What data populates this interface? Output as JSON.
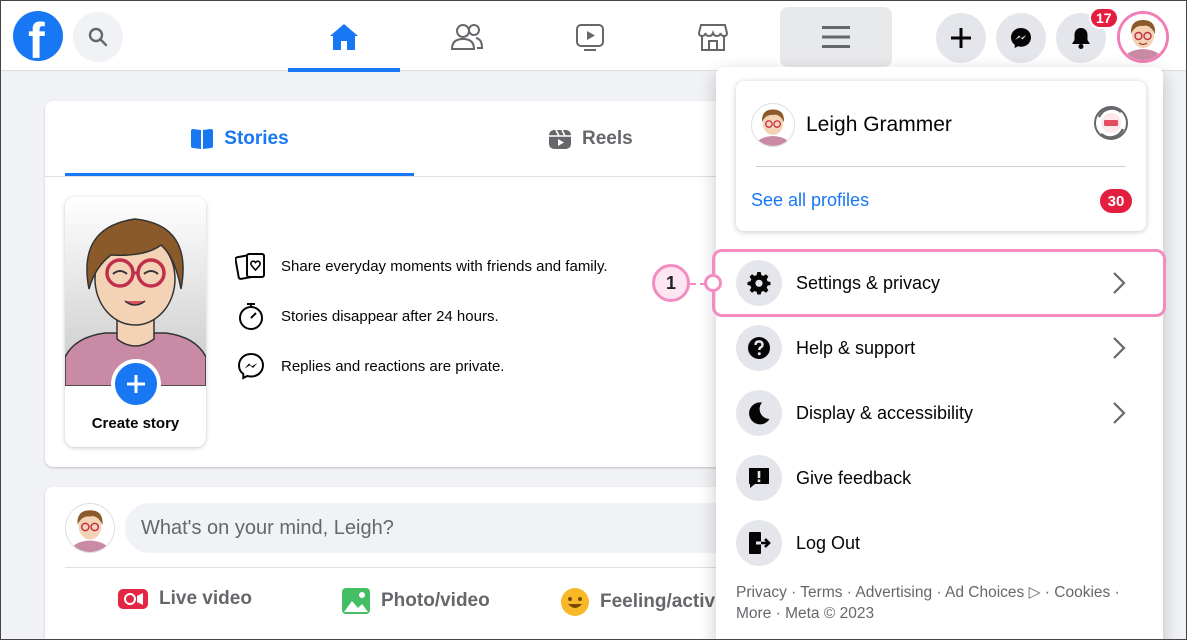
{
  "topbar": {
    "logo_letter": "f",
    "notification_count": "17",
    "icons": [
      "facebook-logo",
      "search-icon",
      "home-icon",
      "friends-icon",
      "watch-icon",
      "marketplace-icon",
      "menu-icon",
      "plus-icon",
      "messenger-icon",
      "bell-icon"
    ]
  },
  "stories": {
    "tabs": [
      {
        "label": "Stories",
        "active": true
      },
      {
        "label": "Reels",
        "active": false
      }
    ],
    "create_label": "Create story",
    "info": [
      "Share everyday moments with friends and family.",
      "Stories disappear after 24 hours.",
      "Replies and reactions are private."
    ]
  },
  "composer": {
    "placeholder": "What's on your mind, Leigh?",
    "actions": [
      "Live video",
      "Photo/video",
      "Feeling/activi"
    ]
  },
  "menu": {
    "profile_name": "Leigh Grammer",
    "see_all": "See all profiles",
    "profiles_count": "30",
    "items": [
      {
        "label": "Settings & privacy",
        "icon": "gear-icon",
        "chevron": true
      },
      {
        "label": "Help & support",
        "icon": "question-icon",
        "chevron": true
      },
      {
        "label": "Display & accessibility",
        "icon": "moon-icon",
        "chevron": true
      },
      {
        "label": "Give feedback",
        "icon": "feedback-icon",
        "chevron": false
      },
      {
        "label": "Log Out",
        "icon": "logout-icon",
        "chevron": false
      }
    ],
    "footer_line1": "Privacy · Terms · Advertising · Ad Choices ▷ · Cookies ·",
    "footer_line2": "More · Meta © 2023"
  },
  "callout": {
    "number": "1"
  },
  "colors": {
    "brand": "#1877f2",
    "highlight": "#f48cc0",
    "badge": "#e41e3f"
  }
}
